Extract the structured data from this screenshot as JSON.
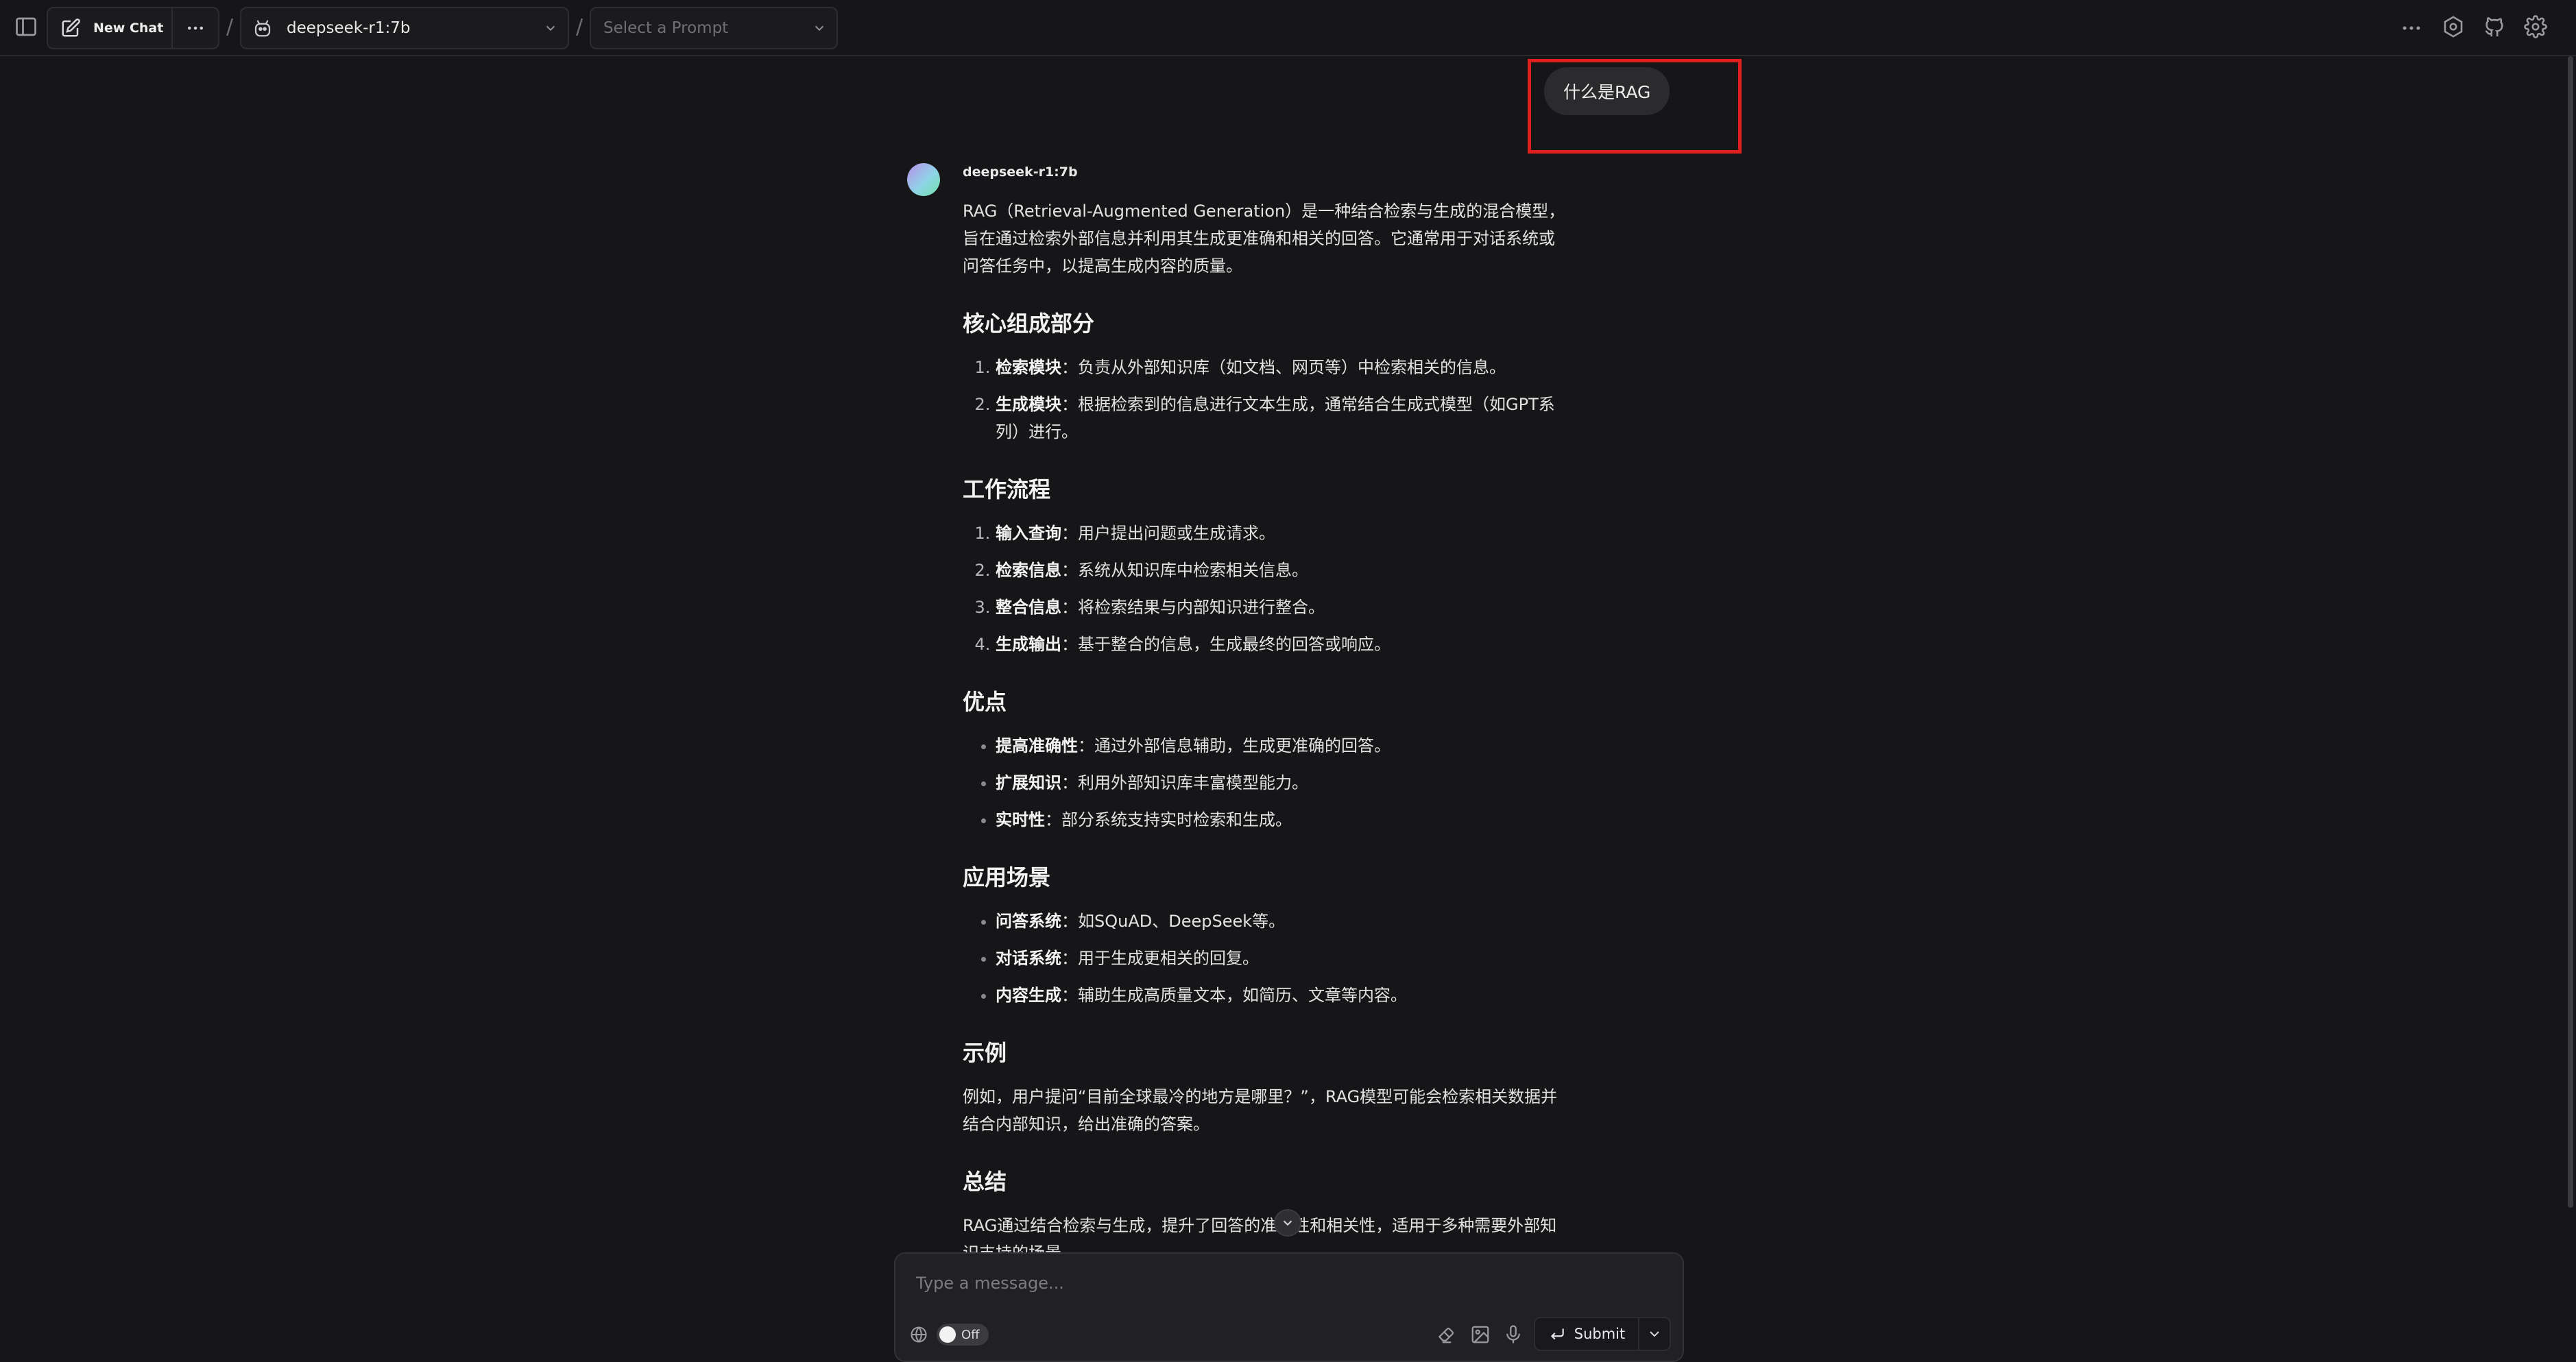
{
  "header": {
    "new_chat_label": "New Chat",
    "separator": "/",
    "model_name": "deepseek-r1:7b",
    "prompt_placeholder": "Select a Prompt"
  },
  "conversation": {
    "user_message": "什么是RAG",
    "assistant_name": "deepseek-r1:7b",
    "intro": "RAG（Retrieval-Augmented Generation）是一种结合检索与生成的混合模型，旨在通过检索外部信息并利用其生成更准确和相关的回答。它通常用于对话系统或问答任务中，以提高生成内容的质量。",
    "sections": [
      {
        "heading": "核心组成部分",
        "style": "ordered",
        "items": [
          {
            "term": "检索模块",
            "sep": "：",
            "desc": "负责从外部知识库（如文档、网页等）中检索相关的信息。"
          },
          {
            "term": "生成模块",
            "sep": "：",
            "desc": "根据检索到的信息进行文本生成，通常结合生成式模型（如GPT系列）进行。"
          }
        ]
      },
      {
        "heading": "工作流程",
        "style": "ordered",
        "items": [
          {
            "term": "输入查询",
            "sep": "：",
            "desc": "用户提出问题或生成请求。"
          },
          {
            "term": "检索信息",
            "sep": "：",
            "desc": "系统从知识库中检索相关信息。"
          },
          {
            "term": "整合信息",
            "sep": "：",
            "desc": "将检索结果与内部知识进行整合。"
          },
          {
            "term": "生成输出",
            "sep": "：",
            "desc": "基于整合的信息，生成最终的回答或响应。"
          }
        ]
      },
      {
        "heading": "优点",
        "style": "bullet",
        "items": [
          {
            "term": "提高准确性",
            "sep": "：",
            "desc": "通过外部信息辅助，生成更准确的回答。"
          },
          {
            "term": "扩展知识",
            "sep": "：",
            "desc": "利用外部知识库丰富模型能力。"
          },
          {
            "term": "实时性",
            "sep": "：",
            "desc": "部分系统支持实时检索和生成。"
          }
        ]
      },
      {
        "heading": "应用场景",
        "style": "bullet",
        "items": [
          {
            "term": "问答系统",
            "sep": "：",
            "desc": "如SQuAD、DeepSeek等。"
          },
          {
            "term": "对话系统",
            "sep": "：",
            "desc": "用于生成更相关的回复。"
          },
          {
            "term": "内容生成",
            "sep": "：",
            "desc": "辅助生成高质量文本，如简历、文章等内容。"
          }
        ]
      }
    ],
    "example_heading": "示例",
    "example_text": "例如，用户提问“目前全球最冷的地方是哪里？”，RAG模型可能会检索相关数据并结合内部知识，给出准确的答案。",
    "summary_heading": "总结",
    "summary_text": "RAG通过结合检索与生成，提升了回答的准确性和相关性，适用于多种需要外部知识支持的场景。"
  },
  "composer": {
    "placeholder": "Type a message...",
    "toggle_label": "Off",
    "submit_label": "Submit"
  },
  "colors": {
    "background": "#161618",
    "highlight_box": "#e0201e"
  }
}
